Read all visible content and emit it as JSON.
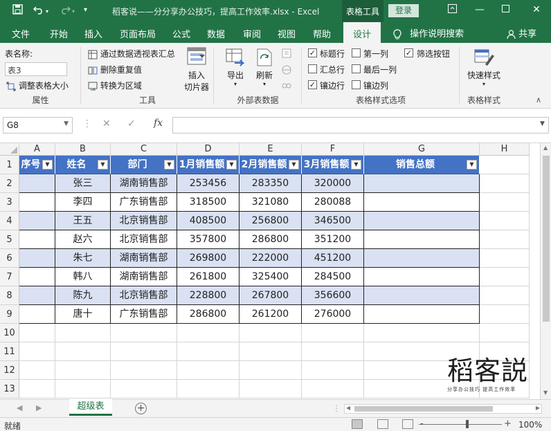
{
  "titlebar": {
    "doc_title": "稻客说——分分享办公技巧，提高工作效率.xlsx  -  Excel",
    "context_tab": "表格工具",
    "login": "登录"
  },
  "menu": {
    "tabs": [
      "文件",
      "开始",
      "插入",
      "页面布局",
      "公式",
      "数据",
      "审阅",
      "视图",
      "帮助",
      "设计"
    ],
    "active_tab": "设计",
    "search": "操作说明搜索",
    "share": "共享"
  },
  "ribbon": {
    "properties": {
      "table_name_label": "表名称:",
      "table_name_value": "表3",
      "resize_label": "调整表格大小",
      "group_title": "属性"
    },
    "tools": {
      "pivot_label": "通过数据透视表汇总",
      "remove_dup_label": "删除重复值",
      "convert_label": "转换为区域",
      "slicer_label_1": "插入",
      "slicer_label_2": "切片器",
      "group_title": "工具"
    },
    "external": {
      "export_label": "导出",
      "refresh_label": "刷新",
      "group_title": "外部表数据"
    },
    "style_options": {
      "header_row": "标题行",
      "first_col": "第一列",
      "filter_btn": "筛选按钮",
      "total_row": "汇总行",
      "last_col": "最后一列",
      "banded_rows": "镶边行",
      "banded_cols": "镶边列",
      "header_row_checked": true,
      "first_col_checked": false,
      "filter_btn_checked": true,
      "total_row_checked": false,
      "last_col_checked": false,
      "banded_rows_checked": true,
      "banded_cols_checked": false,
      "group_title": "表格样式选项"
    },
    "styles": {
      "quick_style_label": "快速样式",
      "group_title": "表格样式"
    }
  },
  "formula_bar": {
    "name_box": "G8",
    "fx": "fx",
    "formula_value": ""
  },
  "sheet": {
    "columns": [
      "A",
      "B",
      "C",
      "D",
      "E",
      "F",
      "G",
      "H"
    ],
    "row_numbers": [
      "1",
      "2",
      "3",
      "4",
      "5",
      "6",
      "7",
      "8",
      "9",
      "10",
      "11",
      "12",
      "13"
    ],
    "headers": [
      "序号",
      "姓名",
      "部门",
      "1月销售额",
      "2月销售额",
      "3月销售额",
      "销售总额"
    ],
    "rows": [
      [
        "",
        "张三",
        "湖南销售部",
        "253456",
        "283350",
        "320000",
        ""
      ],
      [
        "",
        "李四",
        "广东销售部",
        "318500",
        "321080",
        "280088",
        ""
      ],
      [
        "",
        "王五",
        "北京销售部",
        "408500",
        "256800",
        "346500",
        ""
      ],
      [
        "",
        "赵六",
        "北京销售部",
        "357800",
        "286800",
        "351200",
        ""
      ],
      [
        "",
        "朱七",
        "湖南销售部",
        "269800",
        "222000",
        "451200",
        ""
      ],
      [
        "",
        "韩八",
        "湖南销售部",
        "261800",
        "325400",
        "284500",
        ""
      ],
      [
        "",
        "陈九",
        "北京销售部",
        "228800",
        "267800",
        "356600",
        ""
      ],
      [
        "",
        "唐十",
        "广东销售部",
        "286800",
        "261200",
        "276000",
        ""
      ]
    ]
  },
  "watermark": {
    "main": "稻客説",
    "sub": "分享办公技巧 提高工作效率"
  },
  "sheet_tabs": {
    "active": "超级表"
  },
  "status": {
    "ready": "就绪",
    "zoom": "100%",
    "zoom_minus": "-",
    "zoom_plus": "+"
  },
  "colors": {
    "excel_green": "#217346",
    "table_header": "#4472c4",
    "band": "#d9e1f2"
  }
}
